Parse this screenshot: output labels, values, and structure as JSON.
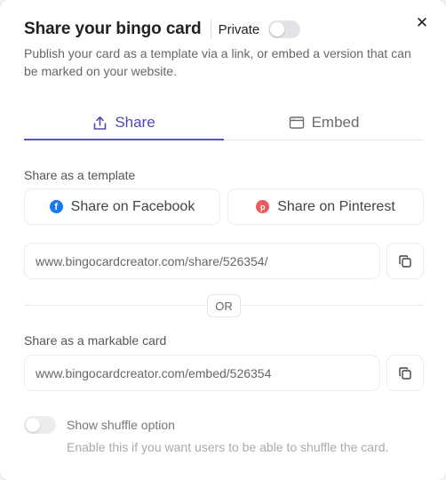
{
  "modal": {
    "title": "Share your bingo card",
    "private_label": "Private",
    "private_enabled": false,
    "close_glyph": "✕",
    "description": "Publish your card as a template via a link, or embed a version that can be marked on your website."
  },
  "tabs": [
    {
      "label": "Share",
      "icon": "share-icon",
      "active": true
    },
    {
      "label": "Embed",
      "icon": "browser-window-icon",
      "active": false
    }
  ],
  "template_section": {
    "label": "Share as a template",
    "facebook_label": "Share on Facebook",
    "pinterest_label": "Share on Pinterest",
    "url": "www.bingocardcreator.com/share/526354/"
  },
  "divider_label": "OR",
  "markable_section": {
    "label": "Share as a markable card",
    "url": "www.bingocardcreator.com/embed/526354"
  },
  "shuffle": {
    "enabled": false,
    "label": "Show shuffle option",
    "description": "Enable this if you want users to be able to shuffle the card."
  },
  "colors": {
    "accent": "#5654c7",
    "facebook": "#1877f2",
    "pinterest": "#e85c5c"
  }
}
